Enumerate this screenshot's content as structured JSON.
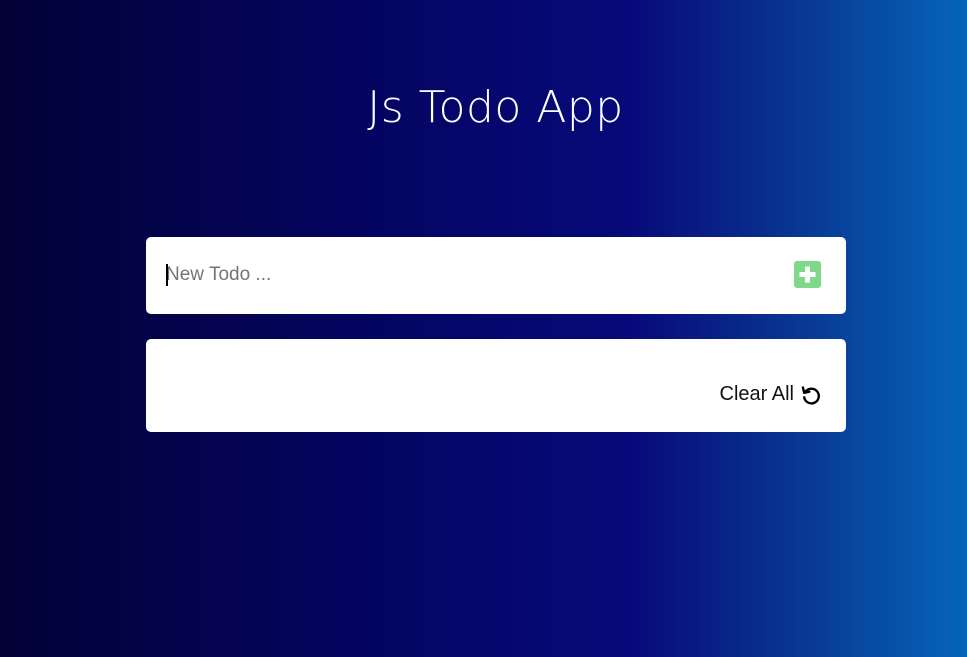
{
  "app": {
    "title": "Js Todo App"
  },
  "input": {
    "placeholder": "New Todo ...",
    "value": ""
  },
  "add_button": {
    "icon": "plus-square-icon",
    "color": "#80d98a"
  },
  "list": {
    "items": [],
    "clear_all_label": "Clear All",
    "clear_all_icon": "undo-icon"
  },
  "colors": {
    "background_start": "#020236",
    "background_mid": "#07097a",
    "background_end": "#0565b8",
    "card": "#ffffff"
  }
}
